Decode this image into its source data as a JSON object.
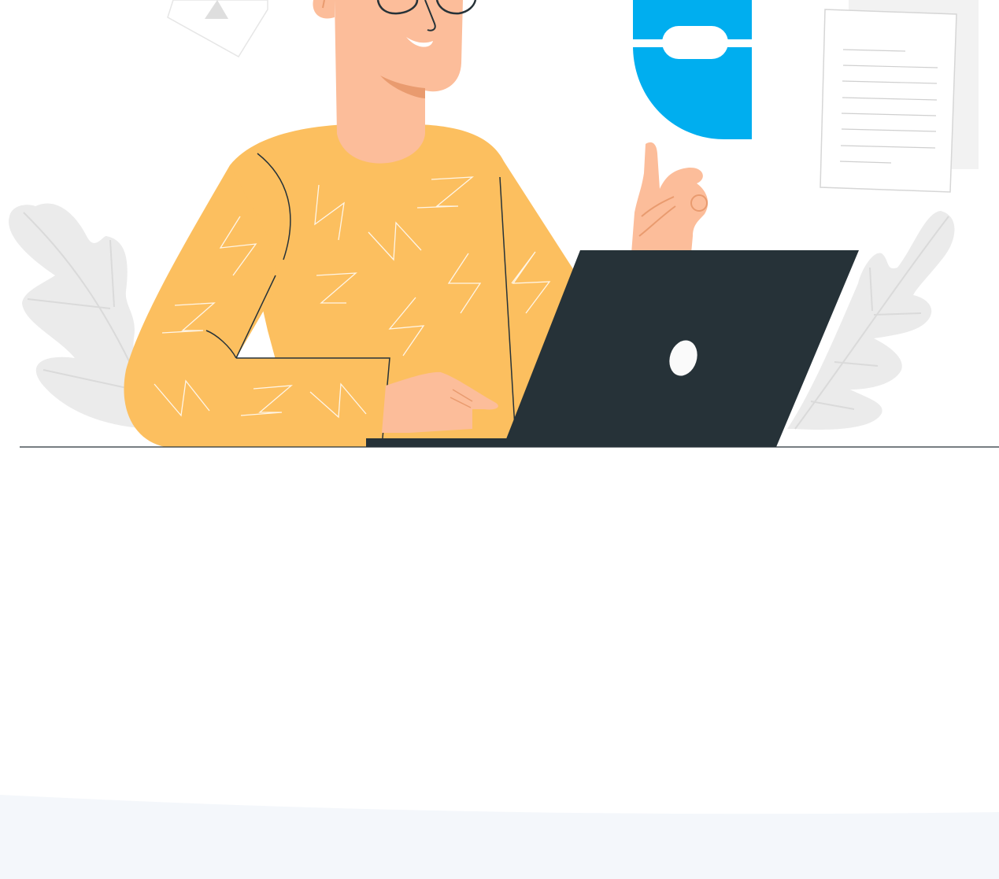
{
  "illustration": {
    "icons": {
      "hero": "person-at-laptop-illustration",
      "logo": "blue-logo-icon",
      "document": "document-icon",
      "warning": "warning-card-icon",
      "leaf_left": "leaf-left-icon",
      "leaf_right": "leaf-right-icon"
    },
    "colors": {
      "sweater": "#FCBF5F",
      "skin": "#FCBD9A",
      "skin_shadow": "#E99B6F",
      "laptop": "#263238",
      "logo_blue": "#00AEEF",
      "leaf": "#EBEBEB",
      "paper_border": "#D6D6D6",
      "band": "#F4F7FB",
      "outline": "#263238"
    }
  }
}
